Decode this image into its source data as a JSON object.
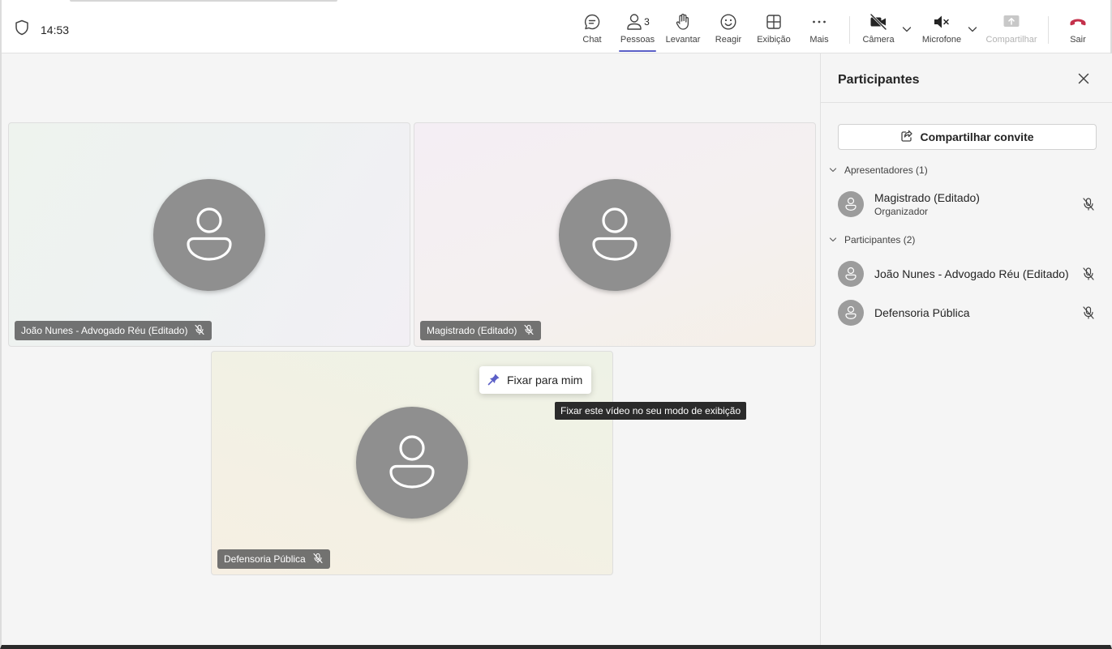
{
  "meeting": {
    "time": "14:53"
  },
  "toolbar": {
    "chat_label": "Chat",
    "people_label": "Pessoas",
    "people_count": "3",
    "raise_label": "Levantar",
    "react_label": "Reagir",
    "view_label": "Exibição",
    "more_label": "Mais",
    "camera_label": "Câmera",
    "mic_label": "Microfone",
    "share_label": "Compartilhar",
    "leave_label": "Sair"
  },
  "colors": {
    "accent": "#5b5fc7",
    "leave": "#c4314b",
    "avatar": "#8f8f8f"
  },
  "tiles": [
    {
      "name": "João Nunes - Advogado Réu (Editado)"
    },
    {
      "name": "Magistrado (Editado)"
    },
    {
      "name": "Defensoria Pública"
    }
  ],
  "pin_menu": {
    "label": "Fixar para mim"
  },
  "tooltip": {
    "text": "Fixar este vídeo no seu modo de exibição"
  },
  "panel": {
    "title": "Participantes",
    "invite_label": "Compartilhar convite",
    "presenters": {
      "heading": "Apresentadores (1)",
      "people": [
        {
          "name": "Magistrado (Editado)",
          "role": "Organizador"
        }
      ]
    },
    "attendees": {
      "heading": "Participantes (2)",
      "people": [
        {
          "name": "João Nunes - Advogado Réu (Editado)"
        },
        {
          "name": "Defensoria Pública"
        }
      ]
    }
  }
}
